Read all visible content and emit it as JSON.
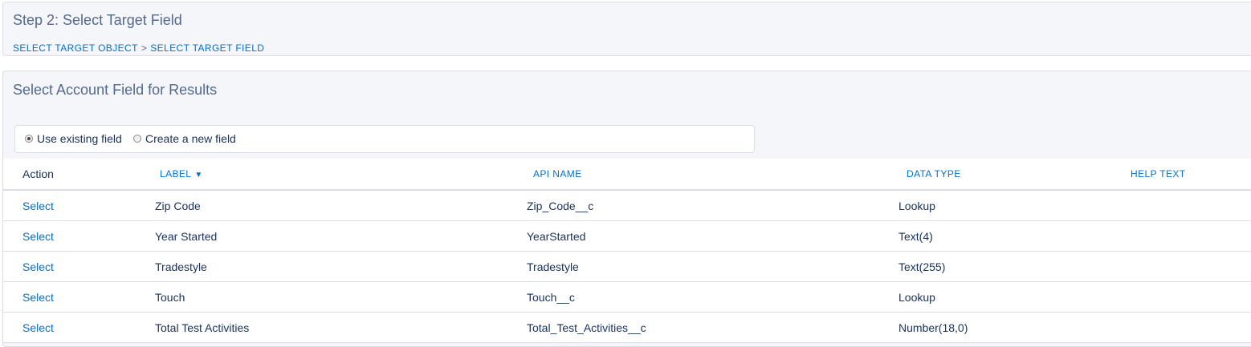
{
  "step": {
    "title": "Step 2: Select Target Field",
    "breadcrumb": {
      "item1": "SELECT TARGET OBJECT",
      "separator": ">",
      "item2": "SELECT TARGET FIELD"
    }
  },
  "results": {
    "title": "Select Account Field for Results",
    "radio_options": {
      "existing": {
        "label": "Use existing field",
        "checked": true
      },
      "new": {
        "label": "Create a new field",
        "checked": false
      }
    }
  },
  "table": {
    "headers": {
      "action": "Action",
      "label": "LABEL",
      "label_sort_icon": "sort-descending-icon",
      "label_sort_glyph": "▼",
      "api_name": "API NAME",
      "data_type": "DATA TYPE",
      "help_text": "HELP TEXT"
    },
    "rows": [
      {
        "action": "Select",
        "label": "Zip Code",
        "api_name": "Zip_Code__c",
        "data_type": "Lookup",
        "help_text": ""
      },
      {
        "action": "Select",
        "label": "Year Started",
        "api_name": "YearStarted",
        "data_type": "Text(4)",
        "help_text": ""
      },
      {
        "action": "Select",
        "label": "Tradestyle",
        "api_name": "Tradestyle",
        "data_type": "Text(255)",
        "help_text": ""
      },
      {
        "action": "Select",
        "label": "Touch",
        "api_name": "Touch__c",
        "data_type": "Lookup",
        "help_text": ""
      },
      {
        "action": "Select",
        "label": "Total Test Activities",
        "api_name": "Total_Test_Activities__c",
        "data_type": "Number(18,0)",
        "help_text": ""
      }
    ]
  },
  "colors": {
    "link": "#0070d2",
    "text": "#16325c",
    "muted": "#54698d",
    "panel_bg": "#f4f6f9",
    "border": "#d8dde6"
  }
}
